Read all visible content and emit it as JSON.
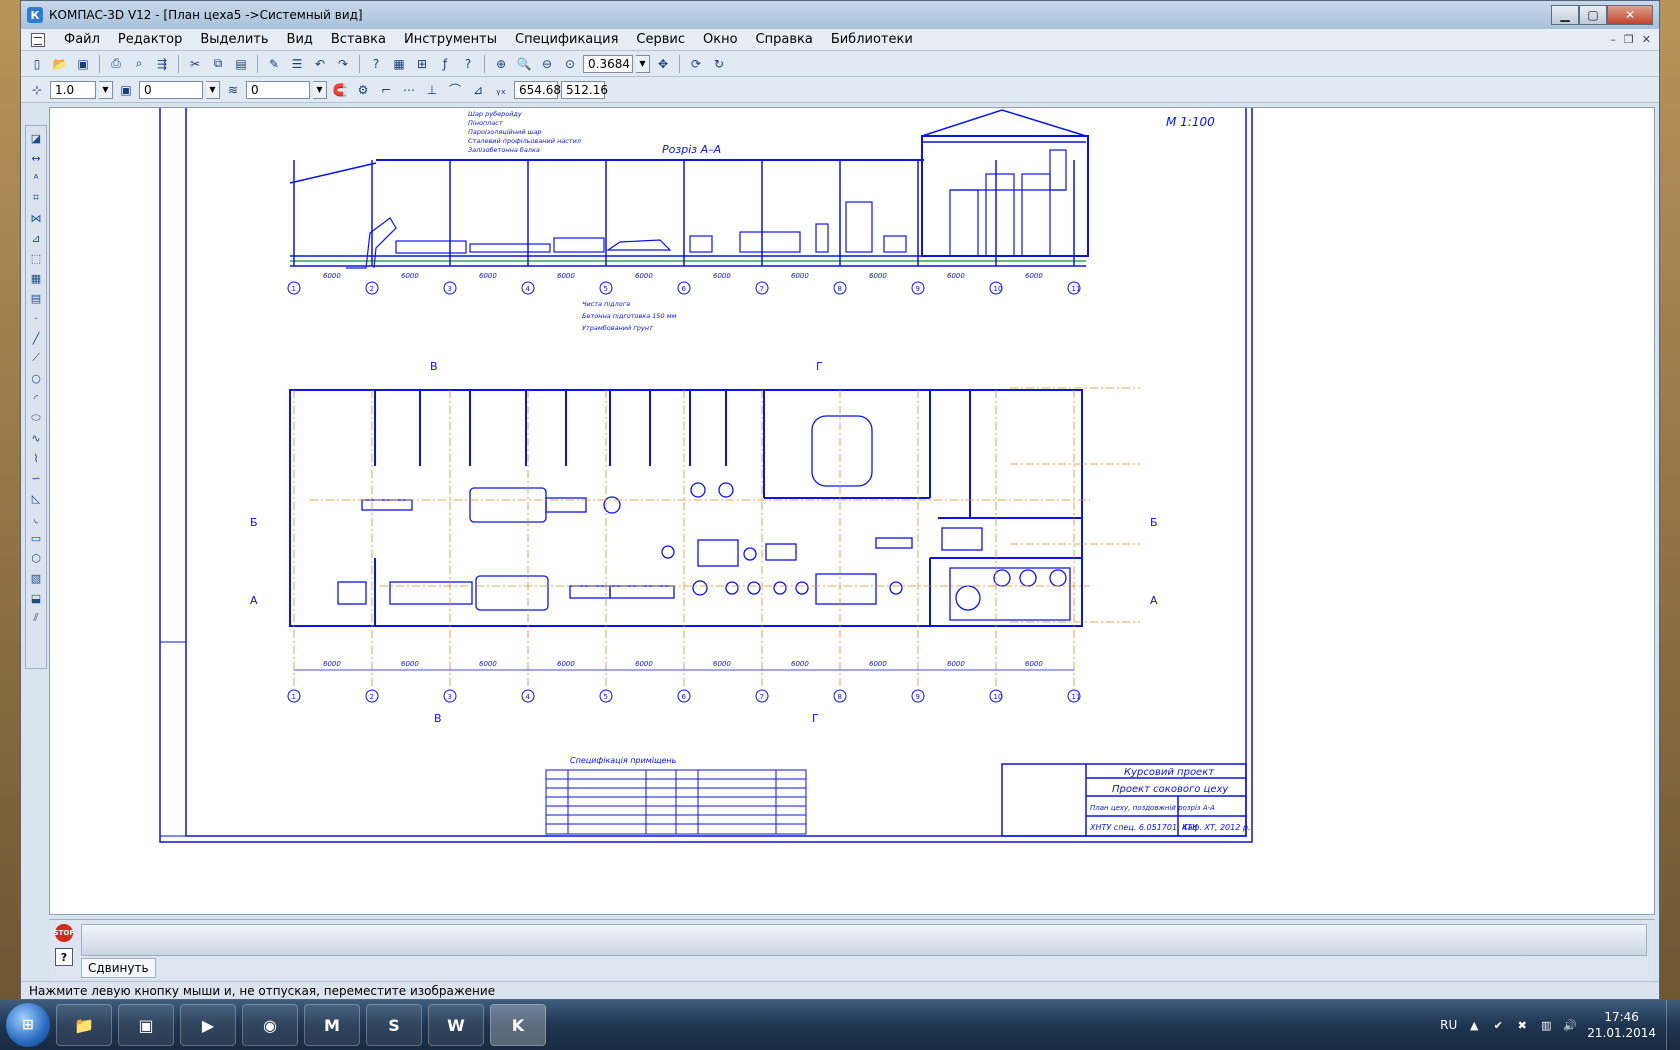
{
  "window": {
    "title": "КОМПАС-3D V12 - [План цеха5 ->Системный вид]",
    "icon": "К"
  },
  "menu": {
    "items": [
      "Файл",
      "Редактор",
      "Выделить",
      "Вид",
      "Вставка",
      "Инструменты",
      "Спецификация",
      "Сервис",
      "Окно",
      "Справка",
      "Библиотеки"
    ]
  },
  "toolbar1": {
    "zoom_value": "0.3684"
  },
  "toolbar2": {
    "line_scale": "1.0",
    "layer_value": "0",
    "style_value": "0",
    "coord_x": "654.68",
    "coord_y": "512.16"
  },
  "drawing": {
    "scale_label": "М 1:100",
    "section_title": "Розріз А–А",
    "floor_labels": [
      "Чиста підлога",
      "Бетонна підготовка 150 мм",
      "Утрамбований ґрунт"
    ],
    "roof_labels": [
      "Шар руберойду",
      "Пінопласт",
      "Пароізоляційний шар",
      "Сталевий профільований настил",
      "Залізобетонна балка"
    ],
    "spans": [
      "6000",
      "6000",
      "6000",
      "6000",
      "6000",
      "6000",
      "6000",
      "6000",
      "6000",
      "6000"
    ],
    "axes": [
      "1",
      "2",
      "3",
      "4",
      "5",
      "6",
      "7",
      "8",
      "9",
      "10",
      "11"
    ],
    "section_markers": [
      "В",
      "Г",
      "Б",
      "А"
    ],
    "spec_title": "Специфікація приміщень",
    "stamp_title1": "Курсовий проект",
    "stamp_title2": "Проект сокового цеху",
    "stamp_sheet": "План цеху, поздовжній розріз А-А",
    "stamp_org": "ХНТУ спец. 6.051701, 4ТК",
    "stamp_dept": "Каф. ХТ, 2012 р."
  },
  "command": {
    "tab_label": "Сдвинуть",
    "stop_label": "STOP"
  },
  "status": {
    "text": "Нажмите левую кнопку мыши и, не отпуская, переместите изображение"
  },
  "taskbar": {
    "apps": [
      "explorer-icon",
      "save-icon",
      "media-icon",
      "chrome-icon",
      "m-icon",
      "skype-icon",
      "word-icon",
      "kompas-icon"
    ],
    "lang": "RU",
    "time": "17:46",
    "date": "21.01.2014"
  },
  "colors": {
    "drawing_blue": "#0a14e6",
    "axis_orange": "#e08a2a"
  }
}
